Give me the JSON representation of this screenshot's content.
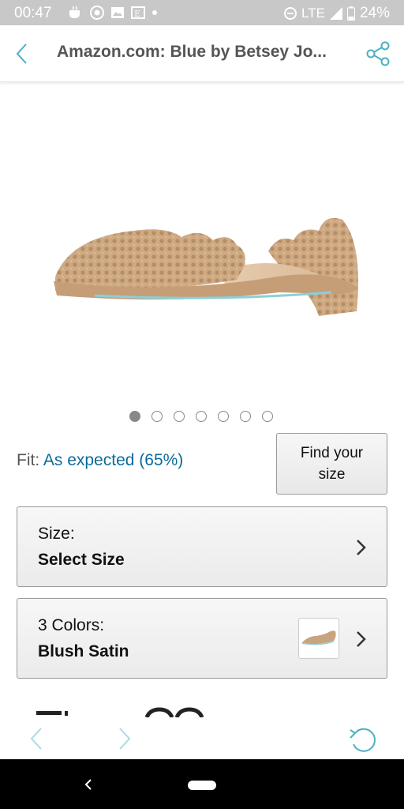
{
  "status_bar": {
    "time": "00:47",
    "network": "LTE",
    "battery": "24%"
  },
  "app_bar": {
    "title": "Amazon.com: Blue by Betsey Jo..."
  },
  "carousel": {
    "total": 7,
    "active_index": 0
  },
  "fit": {
    "label": "Fit:",
    "value": "As expected (65%)"
  },
  "find_size": {
    "line1": "Find your",
    "line2": "size"
  },
  "size_selector": {
    "label": "Size:",
    "value": "Select Size"
  },
  "color_selector": {
    "label": "3 Colors:",
    "value": "Blush Satin"
  },
  "colors": {
    "accent": "#4ab0c1",
    "link": "#0a6b9a",
    "status_bar": "#c8c8c8"
  }
}
